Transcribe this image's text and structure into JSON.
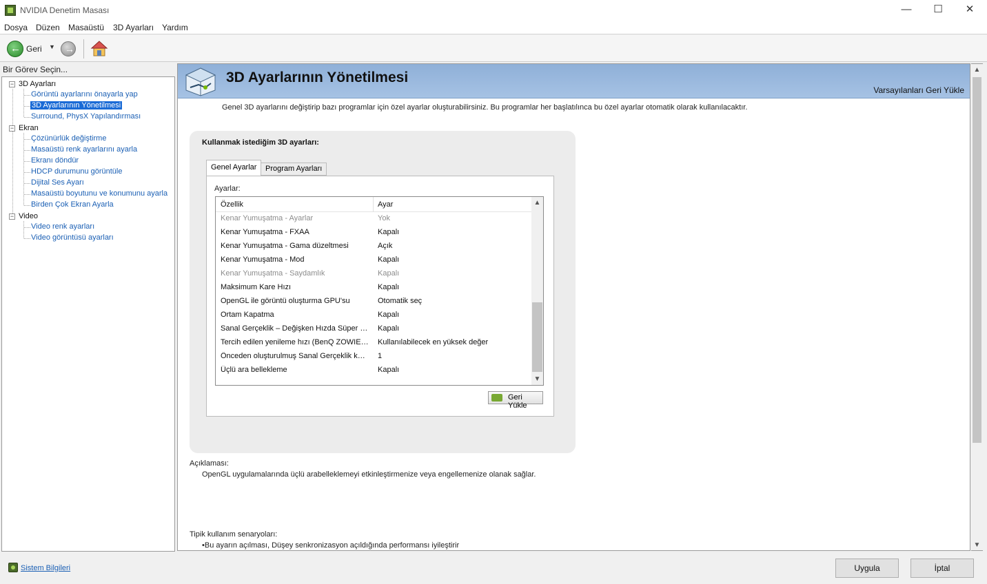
{
  "window": {
    "title": "NVIDIA Denetim Masası"
  },
  "menu": [
    "Dosya",
    "Düzen",
    "Masaüstü",
    "3D Ayarları",
    "Yardım"
  ],
  "toolbar": {
    "back_label": "Geri"
  },
  "task_panel": {
    "header": "Bir Görev Seçin...",
    "groups": [
      {
        "label": "3D Ayarları",
        "items": [
          "Görüntü ayarlarını önayarla yap",
          "3D Ayarlarının Yönetilmesi",
          "Surround, PhysX Yapılandırması"
        ]
      },
      {
        "label": "Ekran",
        "items": [
          "Çözünürlük değiştirme",
          "Masaüstü renk ayarlarını ayarla",
          "Ekranı döndür",
          "HDCP durumunu görüntüle",
          "Dijital Ses Ayarı",
          "Masaüstü boyutunu ve konumunu ayarla",
          "Birden Çok Ekran Ayarla"
        ]
      },
      {
        "label": "Video",
        "items": [
          "Video renk ayarları",
          "Video görüntüsü ayarları"
        ]
      }
    ],
    "selected": "3D Ayarlarının Yönetilmesi",
    "system_info": "Sistem Bilgileri"
  },
  "page": {
    "title": "3D Ayarlarının Yönetilmesi",
    "restore_defaults": "Varsayılanları Geri Yükle",
    "intro": "Genel 3D ayarlarını değiştirip bazı programlar için özel ayarlar oluşturabilirsiniz. Bu programlar her başlatılınca bu özel ayarlar otomatik olarak kullanılacaktır.",
    "box_title": "Kullanmak istediğim 3D ayarları:",
    "tabs": [
      "Genel Ayarlar",
      "Program Ayarları"
    ],
    "settings_label": "Ayarlar:",
    "grid": {
      "headers": [
        "Özellik",
        "Ayar"
      ],
      "rows": [
        {
          "feature": "Kenar Yumuşatma - Ayarlar",
          "value": "Yok",
          "disabled": true
        },
        {
          "feature": "Kenar Yumuşatma - FXAA",
          "value": "Kapalı",
          "disabled": false
        },
        {
          "feature": "Kenar Yumuşatma - Gama düzeltmesi",
          "value": "Açık",
          "disabled": false
        },
        {
          "feature": "Kenar Yumuşatma - Mod",
          "value": "Kapalı",
          "disabled": false
        },
        {
          "feature": "Kenar Yumuşatma - Saydamlık",
          "value": "Kapalı",
          "disabled": true
        },
        {
          "feature": "Maksimum Kare Hızı",
          "value": "Kapalı",
          "disabled": false
        },
        {
          "feature": "OpenGL ile görüntü oluşturma GPU'su",
          "value": "Otomatik seç",
          "disabled": false
        },
        {
          "feature": "Ortam Kapatma",
          "value": "Kapalı",
          "disabled": false
        },
        {
          "feature": "Sanal Gerçeklik – Değişken Hızda Süper Ör...",
          "value": "Kapalı",
          "disabled": false
        },
        {
          "feature": "Tercih edilen yenileme hızı (BenQ ZOWIE X...",
          "value": "Kullanılabilecek en yüksek değer",
          "disabled": false
        },
        {
          "feature": "Önceden oluşturulmuş Sanal Gerçeklik kar...",
          "value": "1",
          "disabled": false
        },
        {
          "feature": "Üçlü ara bellekleme",
          "value": "Kapalı",
          "disabled": false
        }
      ]
    },
    "restore_button": "Geri Yükle",
    "description_label": "Açıklaması:",
    "description": "OpenGL uygulamalarında üçlü arabelleklemeyi etkinleştirmenize veya engellemenize olanak sağlar.",
    "usage_label": "Tipik kullanım senaryoları:",
    "usage_items": [
      "Bu ayarın açılması, Düşey senkronizasyon açıldığında performansı iyileştirir"
    ]
  },
  "footer": {
    "apply": "Uygula",
    "cancel": "İptal"
  }
}
